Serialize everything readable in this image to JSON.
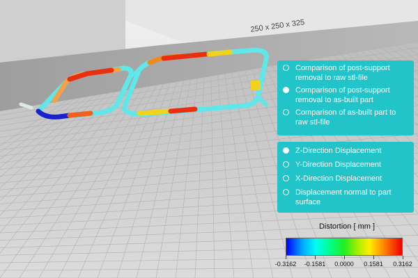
{
  "compare_options": [
    {
      "label": "Comparison of post-support removal to raw stl-file",
      "selected": false
    },
    {
      "label": "Comparison of post-support removal to as-built part",
      "selected": true
    },
    {
      "label": "Comparison of as-built part to raw stl-file",
      "selected": false
    }
  ],
  "direction_options": [
    {
      "label": "Z-Direction Displacement",
      "selected": true
    },
    {
      "label": "Y-Direction Displacement",
      "selected": false
    },
    {
      "label": "X-Direction Displacement",
      "selected": false
    },
    {
      "label": "Displacement normal to part surface",
      "selected": false
    }
  ],
  "legend": {
    "title": "Distortion [ mm ]",
    "ticks": [
      "-0.3162",
      "-0.1581",
      "0.0000",
      "0.1581",
      "0.3162"
    ]
  },
  "build_plate_label": "250 x 250 x 325",
  "colors": {
    "panel": "#21c4c9",
    "part_base": "#5fe7ea",
    "hot": "#e83010",
    "cold": "#1a20cc"
  }
}
